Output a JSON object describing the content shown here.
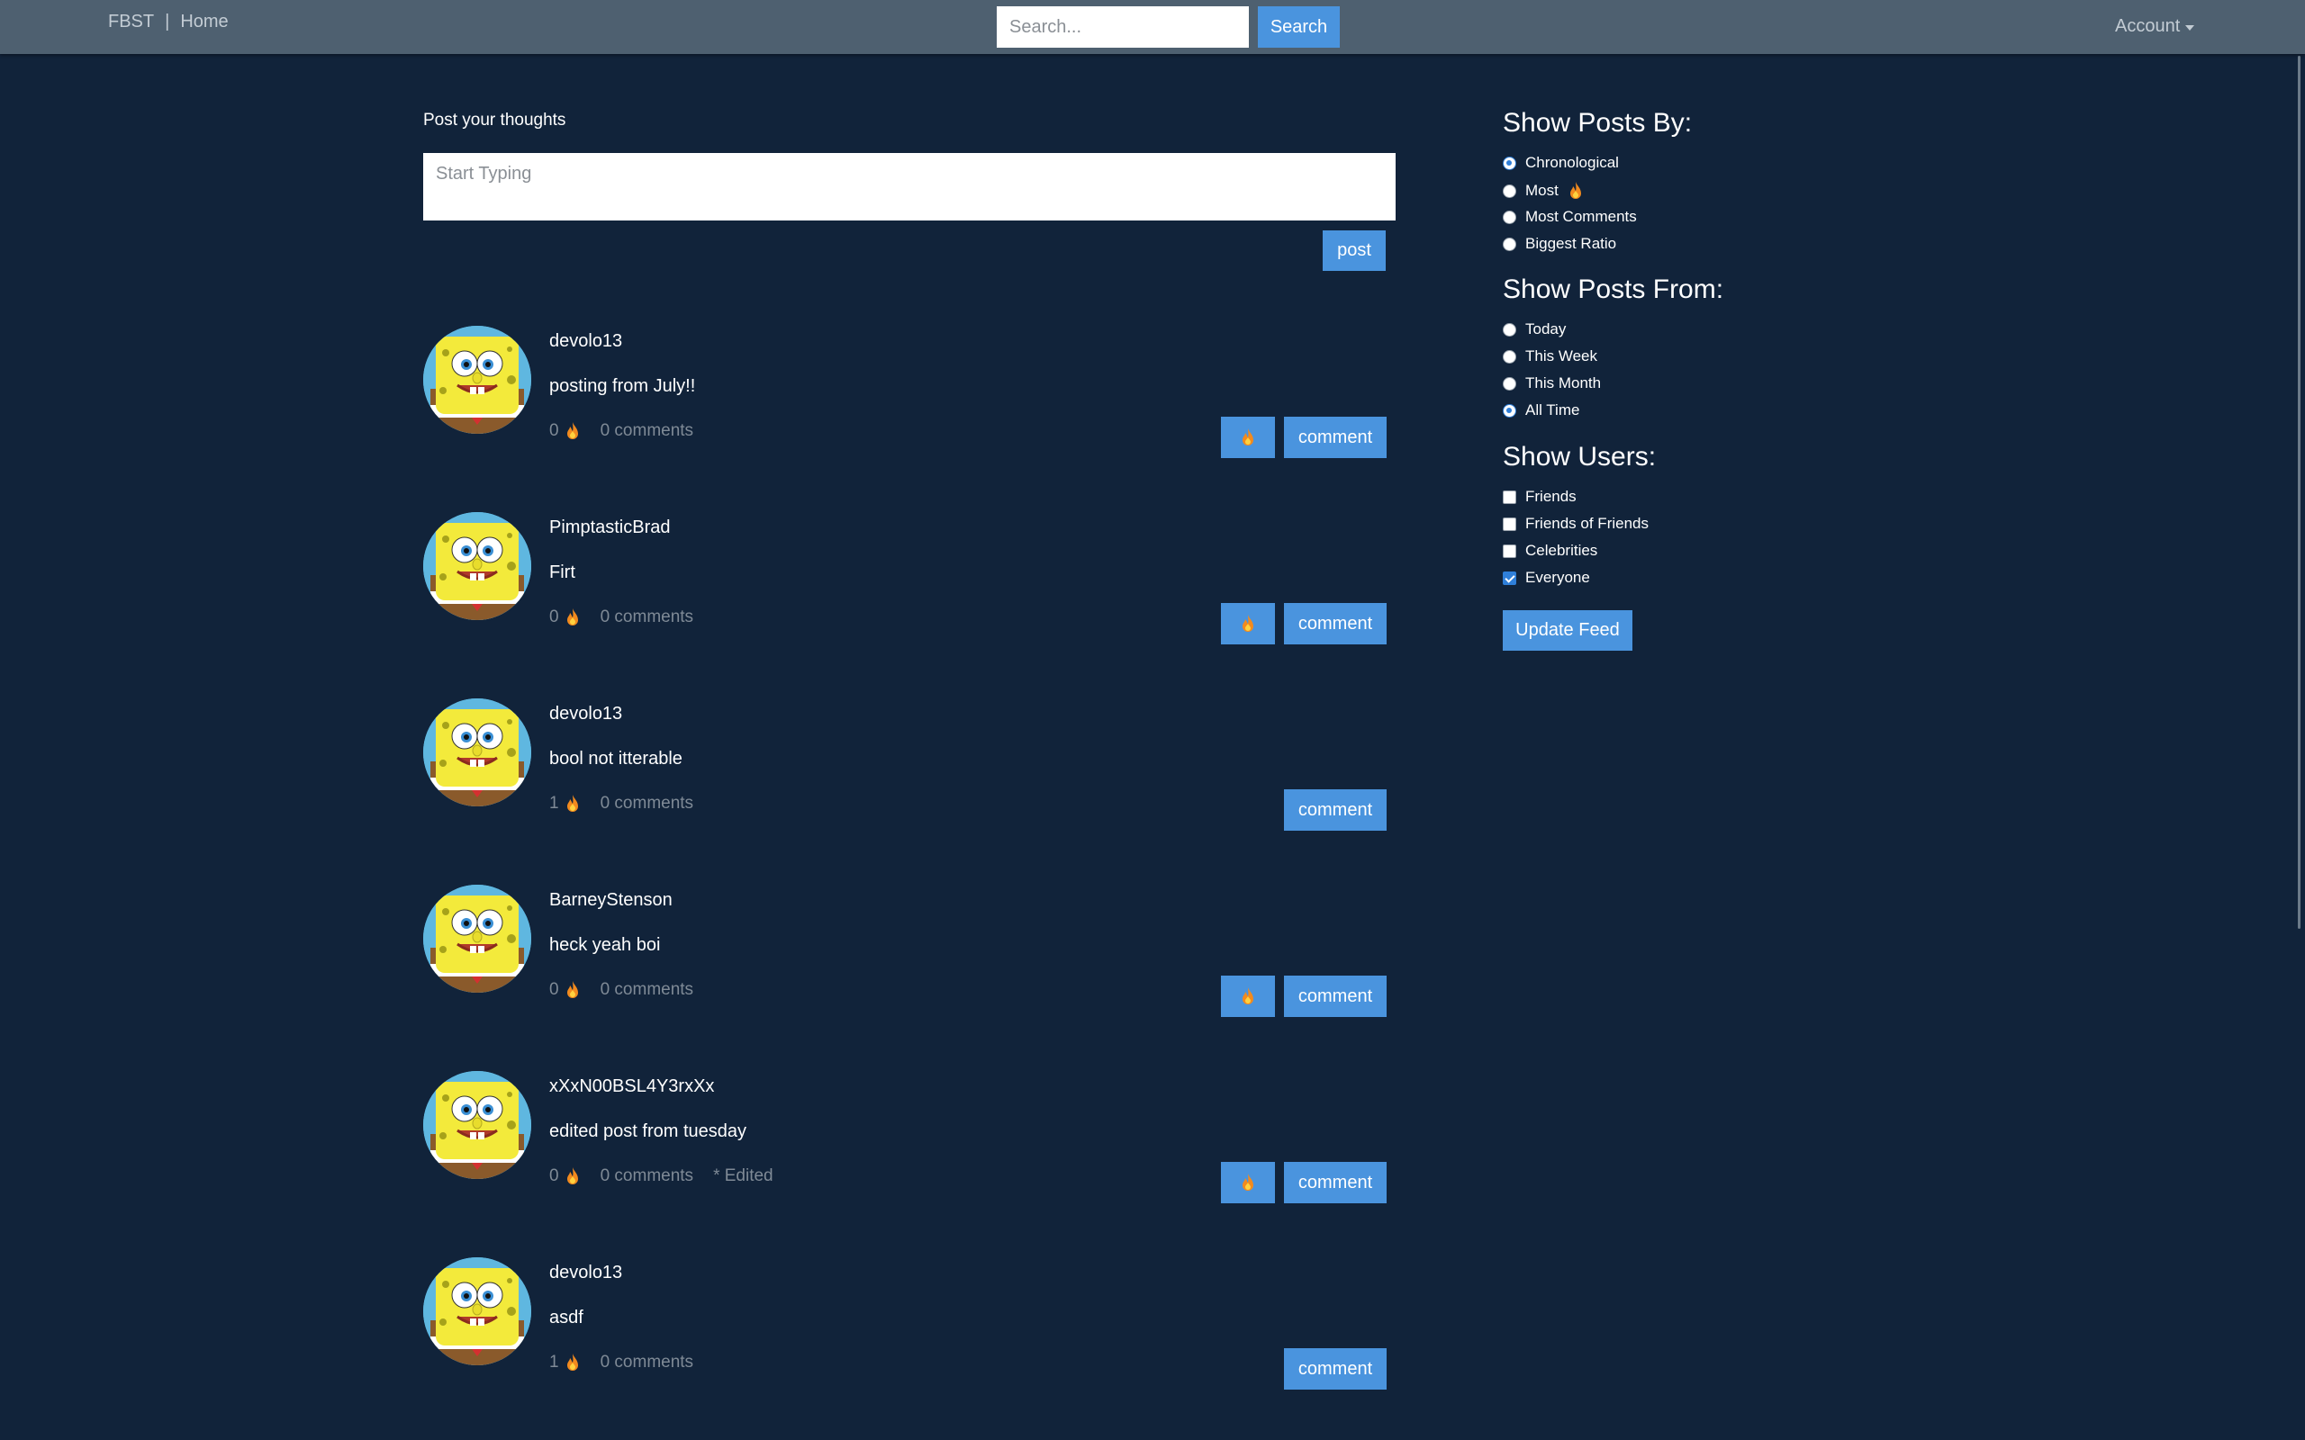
{
  "navbar": {
    "brand": "FBST",
    "separator": "|",
    "home": "Home",
    "search_placeholder": "Search...",
    "search_button": "Search",
    "account": "Account"
  },
  "composer": {
    "label": "Post your thoughts",
    "placeholder": "Start Typing",
    "post_button": "post"
  },
  "posts": [
    {
      "user": "devolo13",
      "text": "posting from July!!",
      "fires": "0",
      "comments": "0 comments",
      "edited": "",
      "fire_button": true,
      "comment_button": "comment"
    },
    {
      "user": "PimptasticBrad",
      "text": "Firt",
      "fires": "0",
      "comments": "0 comments",
      "edited": "",
      "fire_button": true,
      "comment_button": "comment"
    },
    {
      "user": "devolo13",
      "text": "bool not itterable",
      "fires": "1",
      "comments": "0 comments",
      "edited": "",
      "fire_button": false,
      "comment_button": "comment"
    },
    {
      "user": "BarneyStenson",
      "text": "heck yeah boi",
      "fires": "0",
      "comments": "0 comments",
      "edited": "",
      "fire_button": true,
      "comment_button": "comment"
    },
    {
      "user": "xXxN00BSL4Y3rxXx",
      "text": "edited post from tuesday",
      "fires": "0",
      "comments": "0 comments",
      "edited": "* Edited",
      "fire_button": true,
      "comment_button": "comment"
    },
    {
      "user": "devolo13",
      "text": "asdf",
      "fires": "1",
      "comments": "0 comments",
      "edited": "",
      "fire_button": false,
      "comment_button": "comment"
    }
  ],
  "sidebar": {
    "sort_heading": "Show Posts By:",
    "sort_options": [
      {
        "label": "Chronological",
        "selected": true,
        "fire": false
      },
      {
        "label": "Most",
        "selected": false,
        "fire": true
      },
      {
        "label": "Most Comments",
        "selected": false,
        "fire": false
      },
      {
        "label": "Biggest Ratio",
        "selected": false,
        "fire": false
      }
    ],
    "time_heading": "Show Posts From:",
    "time_options": [
      {
        "label": "Today",
        "selected": false
      },
      {
        "label": "This Week",
        "selected": false
      },
      {
        "label": "This Month",
        "selected": false
      },
      {
        "label": "All Time",
        "selected": true
      }
    ],
    "users_heading": "Show Users:",
    "user_options": [
      {
        "label": "Friends",
        "checked": false
      },
      {
        "label": "Friends of Friends",
        "checked": false
      },
      {
        "label": "Celebrities",
        "checked": false
      },
      {
        "label": "Everyone",
        "checked": true
      }
    ],
    "update_button": "Update Feed"
  },
  "colors": {
    "background": "#11233a",
    "navbar": "#4e6070",
    "button": "#4a94de",
    "fire": "#f28a1e"
  }
}
